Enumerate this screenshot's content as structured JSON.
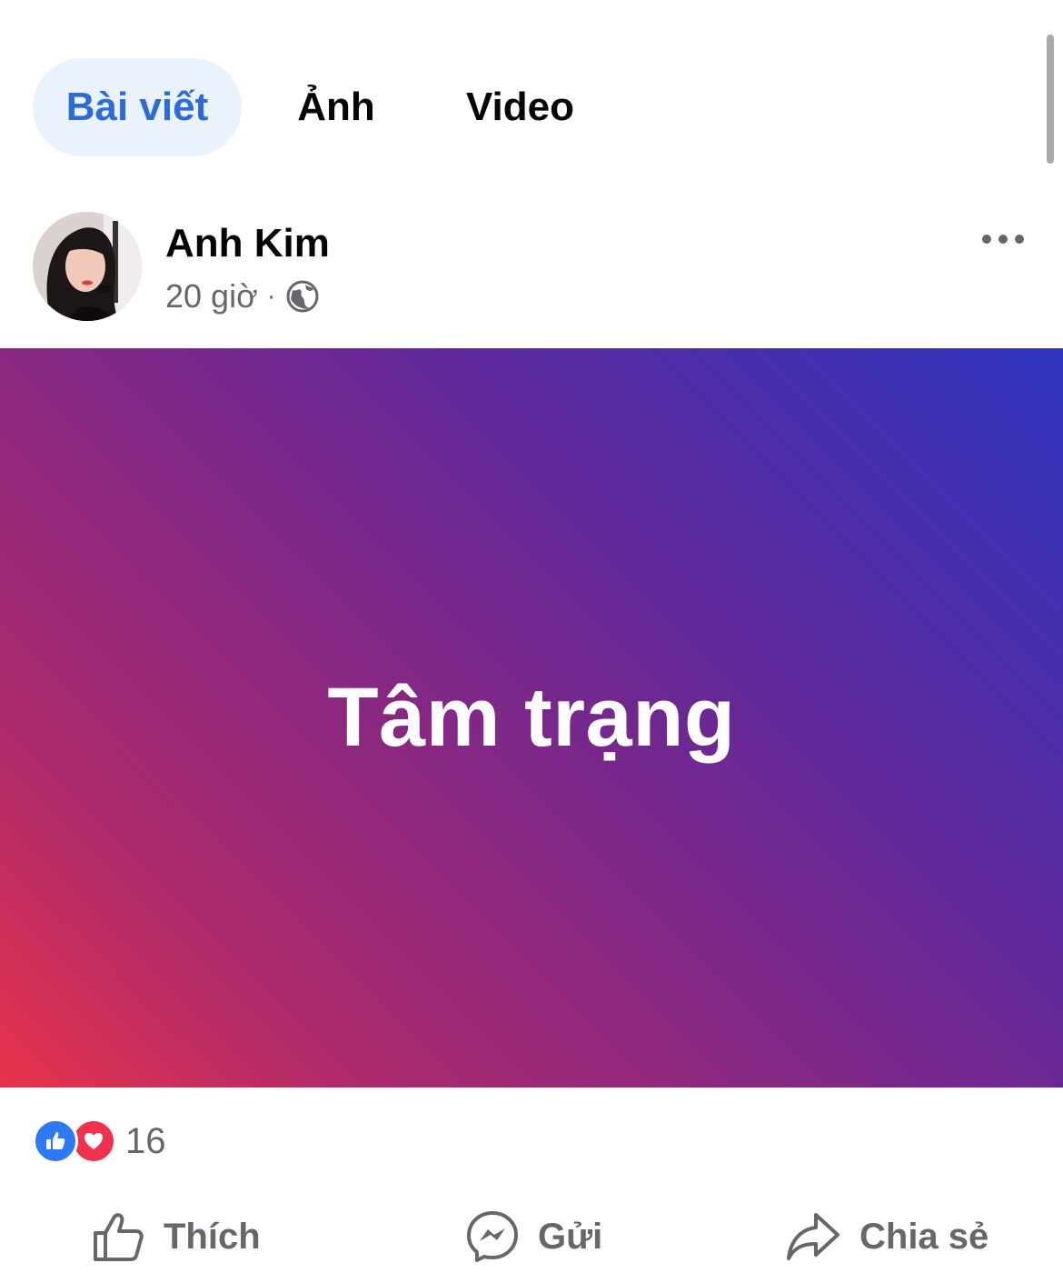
{
  "tabs": [
    {
      "label": "Bài viết",
      "active": true
    },
    {
      "label": "Ảnh",
      "active": false
    },
    {
      "label": "Video",
      "active": false
    }
  ],
  "post": {
    "author": "Anh Kim",
    "time": "20 giờ",
    "separator": "·",
    "privacy_icon": "globe-icon",
    "status_text": "Tâm trạng",
    "background_colors": [
      "#2f35bf",
      "#8c2880",
      "#e8334b"
    ],
    "reaction_icons": [
      "like-reaction-icon",
      "love-reaction-icon"
    ],
    "reaction_count": "16"
  },
  "actions": {
    "like_label": "Thích",
    "send_label": "Gửi",
    "share_label": "Chia sẻ"
  },
  "colors": {
    "accent": "#2f6bd6",
    "accent_bg": "#e9f2fd",
    "secondary_text": "#65676b"
  }
}
